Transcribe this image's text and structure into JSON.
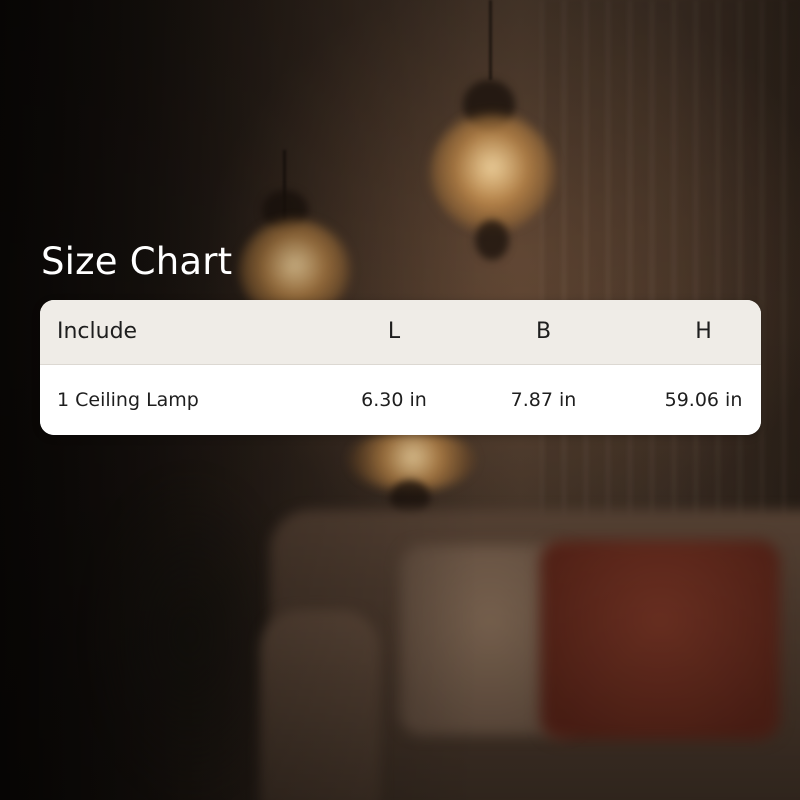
{
  "title": "Size Chart",
  "table": {
    "headers": {
      "include": "Include",
      "l": "L",
      "b": "B",
      "h": "H"
    },
    "rows": [
      {
        "include": "1 Ceiling Lamp",
        "l": "6.30 in",
        "b": "7.87 in",
        "h": "59.06 in"
      }
    ]
  },
  "colors": {
    "header_bg": "#efece7",
    "row_bg": "#ffffff",
    "title_text": "#ffffff",
    "table_text": "#1e1e1e"
  }
}
